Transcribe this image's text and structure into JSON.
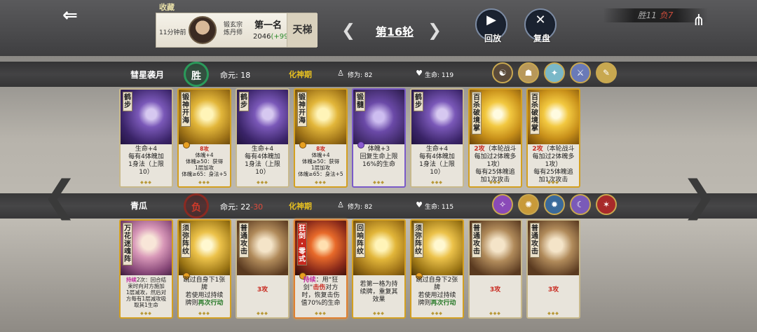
{
  "header": {
    "favorite_label": "收藏",
    "time_ago": "11分钟前",
    "sect": "锻玄宗",
    "profession": "炼丹师",
    "rank_label": "第一名",
    "score": "2046",
    "score_delta": "(+99)",
    "ladder_label": "天梯",
    "round_label": "第16轮",
    "replay_label": "回放",
    "review_label": "复盘",
    "wins_label": "胜11",
    "losses_label": "负7"
  },
  "player1": {
    "name": "彗星袭月",
    "result": "胜",
    "life_label": "命元:",
    "life_value": "18",
    "realm": "化神期",
    "cultivation_label": "修为:",
    "cultivation_value": "82",
    "hp_label": "生命:",
    "hp_value": "119",
    "skills": [
      "skill-1",
      "skill-2",
      "skill-3",
      "skill-4",
      "skill-5"
    ],
    "cards": [
      {
        "title": "鹤步",
        "desc": [
          "生命+4",
          "每有4体魄加",
          "1身法（上限",
          "10）"
        ]
      },
      {
        "title": "锻神开海",
        "desc_red": "8攻",
        "desc": [
          "体魄+4",
          "体魄≥50：获得",
          "1层加攻",
          "体魄≥65：身法+5"
        ]
      },
      {
        "title": "鹤步",
        "desc": [
          "生命+4",
          "每有4体魄加",
          "1身法（上限",
          "10）"
        ]
      },
      {
        "title": "锻神开海",
        "desc_red": "8攻",
        "desc": [
          "体魄+4",
          "体魄≥50：获得",
          "1层加攻",
          "体魄≥65：身法+5"
        ]
      },
      {
        "title": "锻髓",
        "desc": [
          "体魄+3",
          "回复生命上限",
          "16%的生命"
        ]
      },
      {
        "title": "鹤步",
        "desc": [
          "生命+4",
          "每有4体魄加",
          "1身法（上限",
          "10）"
        ]
      },
      {
        "title": "百杀破境掌",
        "desc_red": "2攻",
        "desc_after": "（本轮战斗",
        "desc": [
          "每加过2体魄多",
          "1攻）",
          "每有25体魄追",
          "加1次攻击"
        ]
      },
      {
        "title": "百杀破境掌",
        "desc_red": "2攻",
        "desc_after": "（本轮战斗",
        "desc": [
          "每加过2体魄多",
          "1攻）",
          "每有25体魄追",
          "加1次攻击"
        ]
      }
    ]
  },
  "player2": {
    "name": "青瓜",
    "result": "负",
    "life_label": "命元:",
    "life_value": "22",
    "life_loss": "-30",
    "realm": "化神期",
    "cultivation_label": "修为:",
    "cultivation_value": "82",
    "hp_label": "生命:",
    "hp_value": "115",
    "skills": [
      "skill-1",
      "skill-2",
      "skill-3",
      "skill-4",
      "skill-5"
    ],
    "cards": [
      {
        "title": "万花迷魂阵",
        "desc_mag": "持续",
        "desc_after": "2次：回合结",
        "desc": [
          "束时向对方施加",
          "1层减攻，然后对",
          "方每有1层减攻吸",
          "取其1生命"
        ]
      },
      {
        "title": "须弥阵纹",
        "desc": [
          "跳过自身下1张",
          "牌",
          "若使用过持续",
          "牌则"
        ],
        "desc_green": "再次行动"
      },
      {
        "title": "普通攻击",
        "desc_red": "3攻",
        "desc": []
      },
      {
        "title": "狂剑·零式",
        "desc_mag": "持续",
        "desc_after": "：用“狂",
        "desc_line2a": "剑”",
        "desc_line2r": "击伤",
        "desc_line2b": "对方",
        "desc": [
          "时，恢复击伤",
          "值70%的生命"
        ]
      },
      {
        "title": "回响阵纹",
        "desc": [
          "若第一格为持",
          "续牌，重复其",
          "效果"
        ]
      },
      {
        "title": "须弥阵纹",
        "desc": [
          "跳过自身下2张",
          "牌",
          "若使用过持续",
          "牌则"
        ],
        "desc_green": "再次行动"
      },
      {
        "title": "普通攻击",
        "desc_red": "3攻",
        "desc": []
      },
      {
        "title": "普通攻击",
        "desc_red": "3攻",
        "desc": []
      }
    ]
  },
  "icons": {
    "back": "back-arrow-icon",
    "prev": "chevron-left-icon",
    "next": "chevron-right-icon",
    "replay": "play-icon",
    "review": "crossed-swords-icon",
    "share": "share-icon",
    "cultivation": "meditation-icon",
    "hp": "heart-icon"
  },
  "colors": {
    "win": "#2a9a5a",
    "lose": "#c8281e",
    "realm": "#e8c020",
    "attack": "#c8281e",
    "persist": "#c030a0",
    "again": "#2a7a2a"
  }
}
